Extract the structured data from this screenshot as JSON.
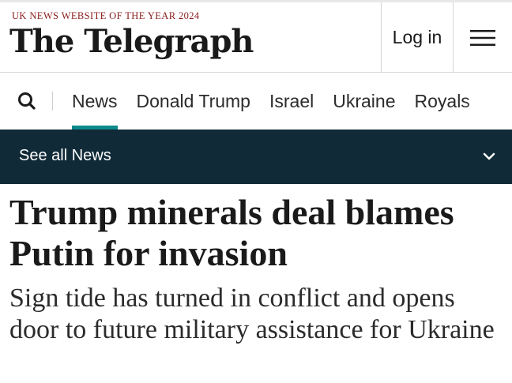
{
  "header": {
    "award": "UK NEWS WEBSITE OF THE YEAR 2024",
    "logo_text": "The Telegraph",
    "login_label": "Log in"
  },
  "icons": {
    "search": "search-icon",
    "menu": "hamburger-menu-icon",
    "chevron": "chevron-down-icon"
  },
  "nav": {
    "items": [
      {
        "label": "News",
        "active": true
      },
      {
        "label": "Donald Trump"
      },
      {
        "label": "Israel"
      },
      {
        "label": "Ukraine"
      },
      {
        "label": "Royals"
      }
    ]
  },
  "subnav": {
    "label": "See all News"
  },
  "article": {
    "headline": "Trump minerals deal blames Putin for invasion",
    "standfirst": "Sign tide has turned in conflict and opens door to future military assistance for Ukraine"
  },
  "colors": {
    "accent": "#0e8a8a",
    "subnav_bg": "#102a38",
    "award": "#8a1c1c"
  }
}
